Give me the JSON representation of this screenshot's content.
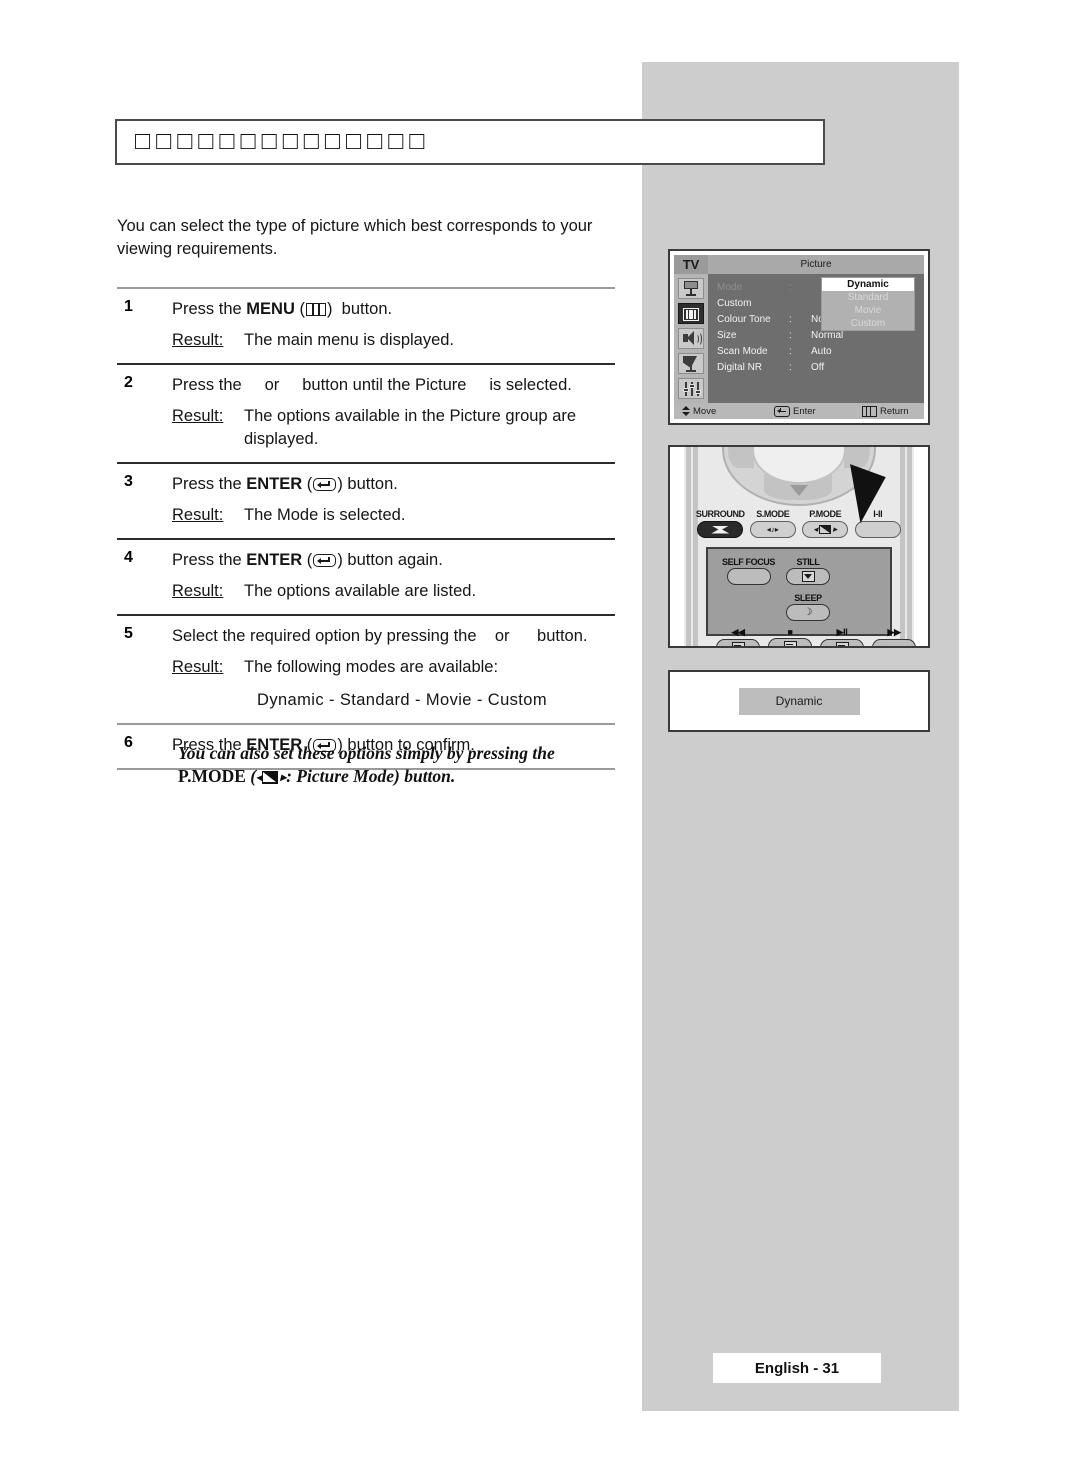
{
  "heading": {
    "text": "□□□□□□□□□□□□□□"
  },
  "intro": {
    "text": "You can select the type of picture which best corresponds to your viewing requirements."
  },
  "steps": [
    {
      "num": "1",
      "instruction_before": "Press the ",
      "instruction_bold": "MENU",
      "instruction_mid": " (",
      "icon": "menu-icon",
      "instruction_after": ")  button.",
      "result_label": "Result:",
      "result_text": "The main menu is displayed."
    },
    {
      "num": "2",
      "instruction_before": "Press the ",
      "instruction_bold": "",
      "instruction_mid": "",
      "icon": "none",
      "instruction_after": "    or     button until the Picture     is selected.",
      "result_label": "Result:",
      "result_text": "The options available in the Picture      group are displayed."
    },
    {
      "num": "3",
      "instruction_before": "Press the ",
      "instruction_bold": "ENTER",
      "instruction_mid": " (",
      "icon": "enter-icon",
      "instruction_after": ") button.",
      "result_label": "Result:",
      "result_text": "The  Mode is selected."
    },
    {
      "num": "4",
      "instruction_before": "Press the ",
      "instruction_bold": "ENTER",
      "instruction_mid": " (",
      "icon": "enter-icon",
      "instruction_after": ") button again.",
      "result_label": "Result:",
      "result_text": "The options available are listed."
    },
    {
      "num": "5",
      "instruction_before": "Select the required option by pressing the ",
      "instruction_bold": "",
      "instruction_mid": "",
      "icon": "none",
      "instruction_after": "   or      button.",
      "result_label": "Result:",
      "result_text": "The following modes are available:",
      "modes": "Dynamic  -  Standard   -  Movie   -  Custom"
    },
    {
      "num": "6",
      "instruction_before": "Press the ",
      "instruction_bold": "ENTER",
      "instruction_mid": " (",
      "icon": "enter-icon",
      "instruction_after": ") button to confirm.",
      "result_label": "",
      "result_text": ""
    }
  ],
  "note": {
    "line1": "You can also set these options simply by pressing the",
    "pmode_label": "P.MODE",
    "tail": ": Picture Mode) button."
  },
  "osd": {
    "tv_label": "TV",
    "title": "Picture",
    "sidebar_icons": [
      "monitor-icon",
      "picture-icon",
      "speaker-icon",
      "satellite-dish-icon",
      "sliders-icon"
    ],
    "selected_icon_index": 1,
    "rows": [
      {
        "name": "Mode",
        "colon": ":",
        "value": "",
        "dim": true
      },
      {
        "name": "Custom",
        "colon": "",
        "value": "",
        "dim": false
      },
      {
        "name": "Colour Tone",
        "colon": ":",
        "value": "Normal",
        "dim": false
      },
      {
        "name": "Size",
        "colon": ":",
        "value": "Normal",
        "dim": false
      },
      {
        "name": "Scan Mode",
        "colon": ":",
        "value": "Auto",
        "dim": false
      },
      {
        "name": "Digital NR",
        "colon": ":",
        "value": "Off",
        "dim": false
      }
    ],
    "dropdown": {
      "options": [
        "Dynamic",
        "Standard",
        "Movie",
        "Custom"
      ],
      "selected": "Dynamic"
    },
    "footer": {
      "move": "Move",
      "enter": "Enter",
      "return": "Return"
    }
  },
  "remote": {
    "top_buttons": [
      {
        "label": "SURROUND",
        "glyph": "surround-glyph"
      },
      {
        "label": "S.MODE",
        "glyph": "smode-glyph"
      },
      {
        "label": "P.MODE",
        "glyph": "pmode-glyph"
      },
      {
        "label": "I-II",
        "glyph": "blank-glyph"
      }
    ],
    "lower_buttons": [
      {
        "label": "SELF FOCUS",
        "glyph": "blank-glyph"
      },
      {
        "label": "STILL",
        "glyph": "still-glyph"
      },
      {
        "label": "SLEEP",
        "glyph": "sleep-glyph"
      }
    ],
    "transport_buttons": [
      {
        "label": "◀◀",
        "glyph": "rewind-glyph"
      },
      {
        "label": "■",
        "glyph": "stop-glyph"
      },
      {
        "label": "▶II",
        "glyph": "play-pause-glyph"
      },
      {
        "label": "▶▶",
        "glyph": "fast-forward-glyph"
      }
    ]
  },
  "result_box": {
    "chip": "Dynamic"
  },
  "footer": {
    "page": "English - 31"
  },
  "colors": {
    "panel_grey": "#cdcdcd",
    "osd_bg": "#6e6e6e",
    "osd_header": "#a9a9a9",
    "highlight_white": "#ffffff",
    "rule": "#9a9a9a"
  }
}
